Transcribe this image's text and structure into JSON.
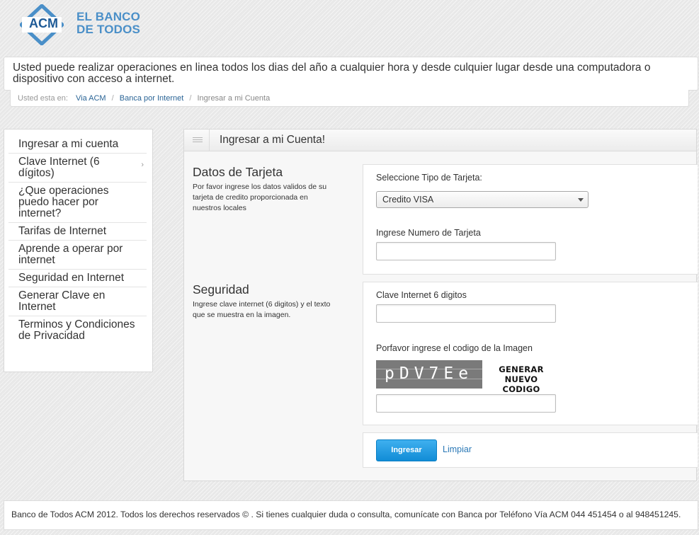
{
  "brand": {
    "logo_abbr": "ACM",
    "line1": "EL BANCO",
    "line2": "DE TODOS",
    "color": "#4a8fc8"
  },
  "notice": "Usted puede realizar operaciones en linea todos los dias del año a cualquier hora y desde culquier lugar desde una computadora o dispositivo con acceso a internet.",
  "breadcrumb": {
    "prefix": "Usted esta en:",
    "items": [
      "Via ACM",
      "Banca por Internet",
      "Ingresar a mi Cuenta"
    ]
  },
  "sidebar": {
    "items": [
      {
        "label": "Ingresar a mi cuenta"
      },
      {
        "label": "Clave Internet (6 dígitos)",
        "chevron": "›"
      },
      {
        "label": "¿Que operaciones puedo hacer por internet?"
      },
      {
        "label": "Tarifas de Internet"
      },
      {
        "label": "Aprende a operar por internet"
      },
      {
        "label": "Seguridad en Internet"
      },
      {
        "label": "Generar Clave en Internet"
      },
      {
        "label": "Terminos y Condiciones de Privacidad"
      }
    ]
  },
  "panel": {
    "title": "Ingresar a mi Cuenta!",
    "menu_icon": "menu-icon"
  },
  "card_section": {
    "title": "Datos de Tarjeta",
    "description": "Por favor ingrese los datos validos de su tarjeta de credito proporcionada en nuestros locales",
    "card_type_label": "Seleccione Tipo de Tarjeta:",
    "card_type_value": "Credito VISA",
    "card_number_label": "Ingrese Numero de Tarjeta",
    "card_number_value": ""
  },
  "security_section": {
    "title": "Seguridad",
    "description": "Ingrese clave internet (6 digitos) y el texto que se muestra en la imagen.",
    "pin_label": "Clave Internet 6 digitos",
    "pin_value": "",
    "captcha_label": "Porfavor ingrese el codigo de la Imagen",
    "captcha_text": "pDV7Ee",
    "generate_line1": "GENERAR",
    "generate_line2": "NUEVO CODIGO",
    "captcha_value": ""
  },
  "actions": {
    "submit_label": "Ingresar",
    "clear_label": "Limpiar",
    "submit_color": "#1a9ae2",
    "link_color": "#2a78b6"
  },
  "footer": "Banco de Todos ACM 2012. Todos los derechos reservados © . Si tienes cualquier duda o consulta, comunícate con Banca por Teléfono Vía ACM 044 451454 o al 948451245."
}
